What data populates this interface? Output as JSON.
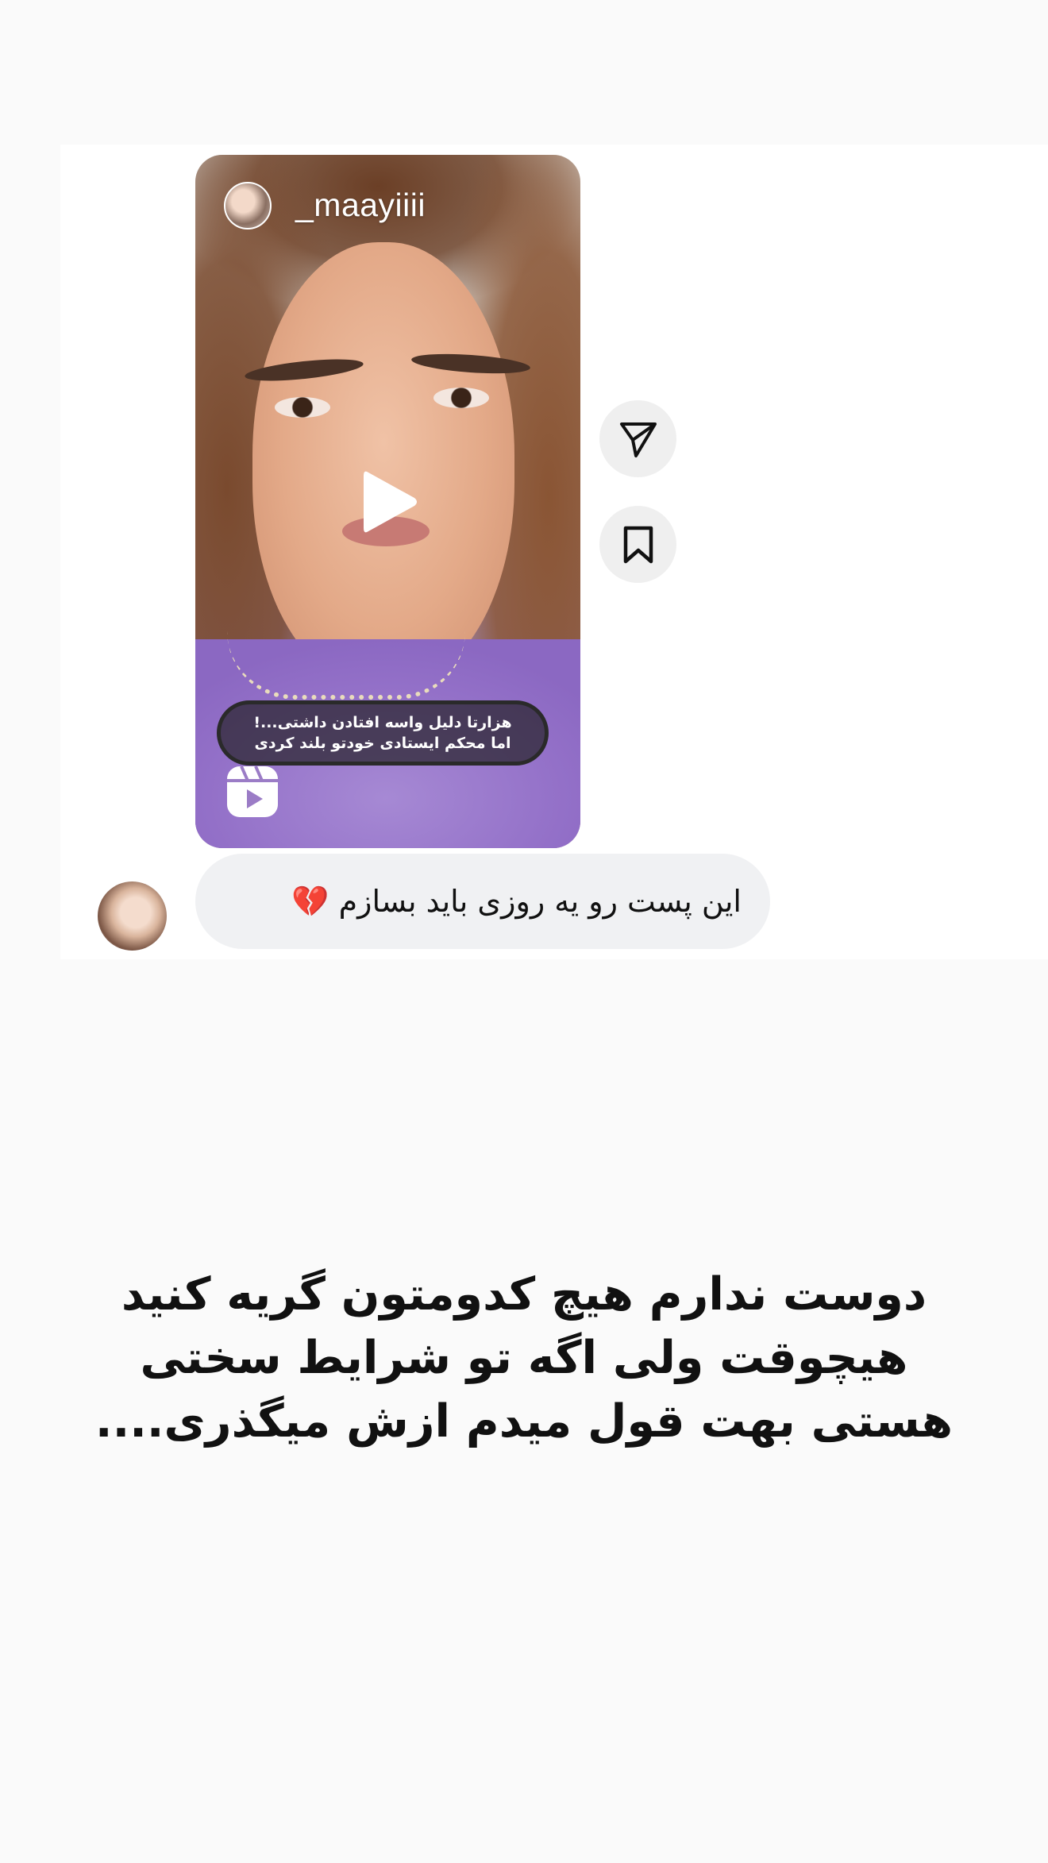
{
  "reel": {
    "username": "_maayiiii",
    "caption_line1": "هزارتا دلیل واسه افتادن داشتی...!",
    "caption_line2": "اما محکم ایستادی خودتو بلند کردی"
  },
  "icons": {
    "play": "play-icon",
    "reels": "reels-icon",
    "share": "paper-plane-icon",
    "save": "bookmark-icon"
  },
  "message": {
    "text": "این پست رو یه روزی باید بسازم 💔"
  },
  "post_text": {
    "line1": "دوست ندارم هیچ کدومتون گریه کنید",
    "line2": "هیچوقت ولی اگه تو شرایط سختی",
    "line3": "هستی بهت قول میدم ازش میگذری...."
  }
}
